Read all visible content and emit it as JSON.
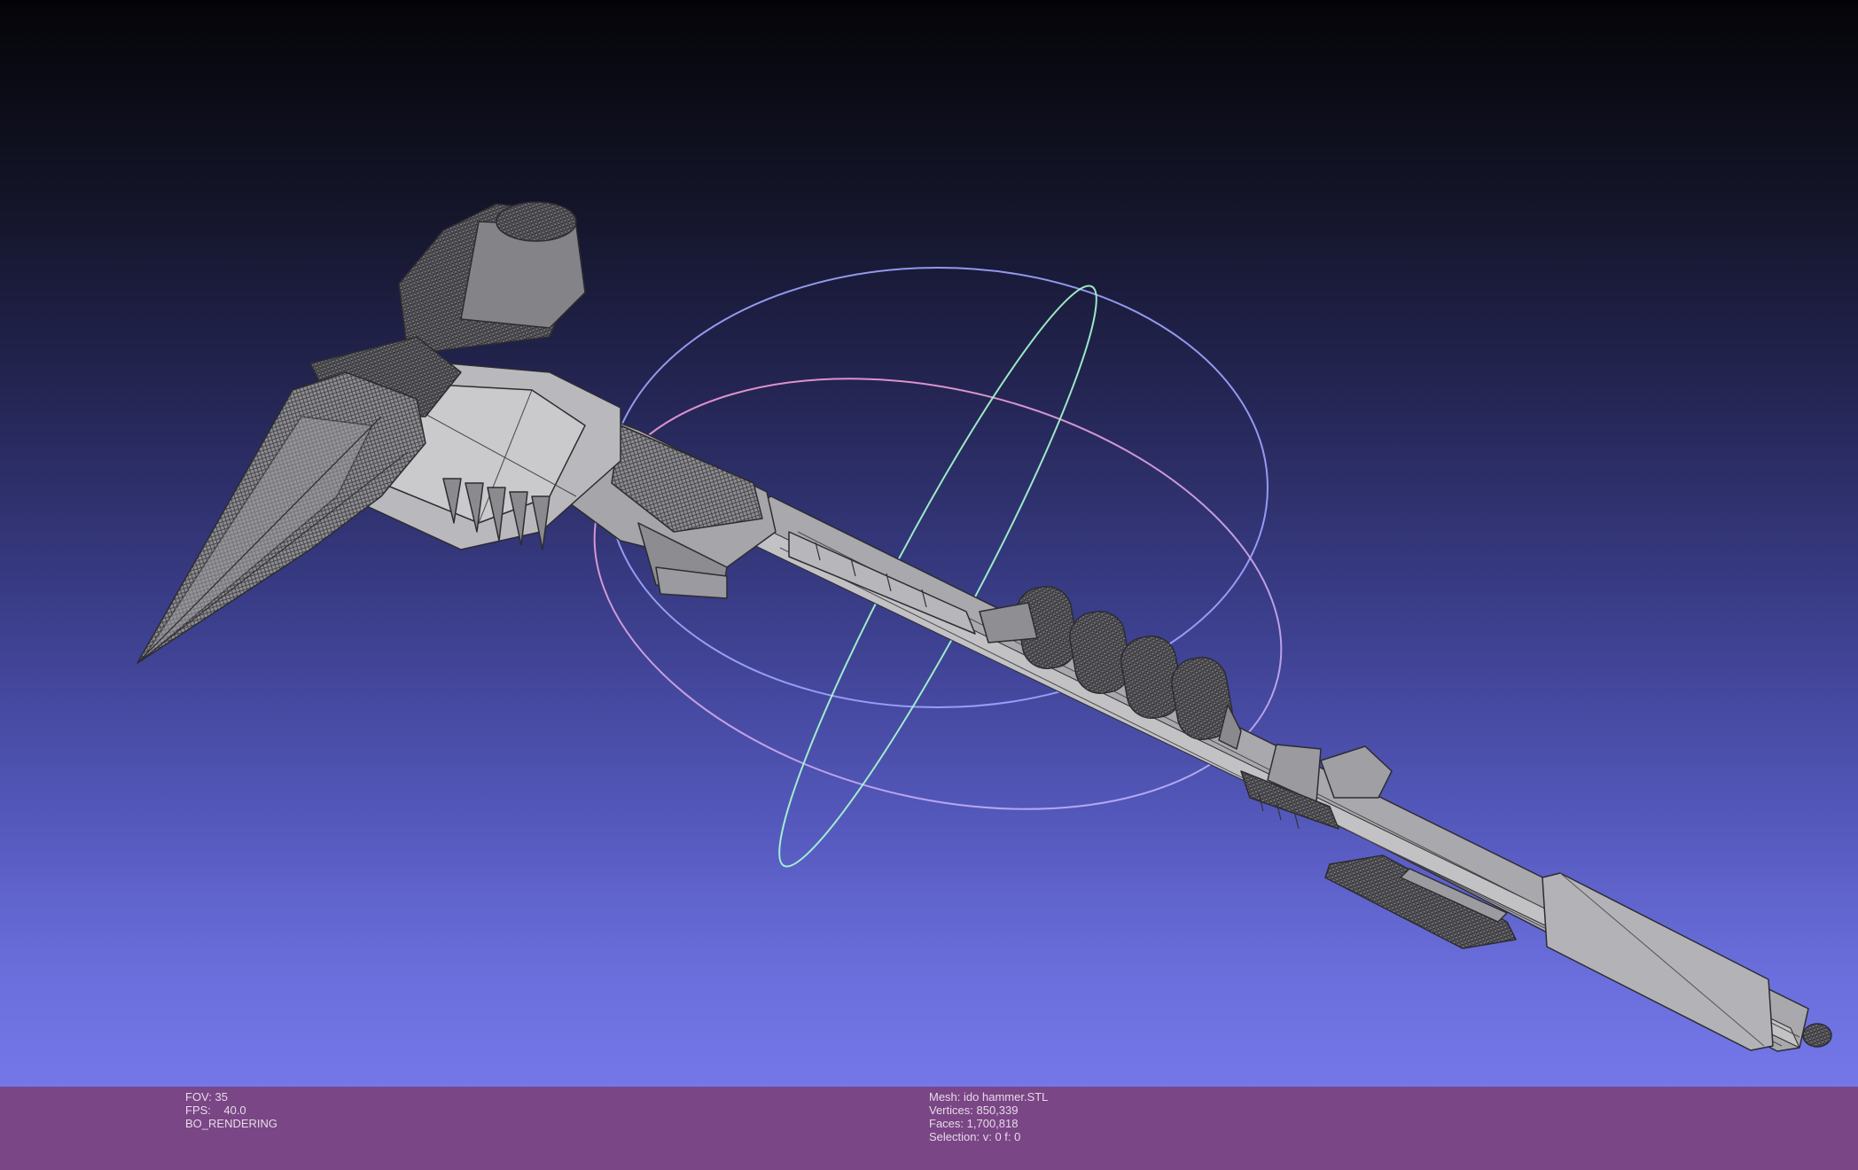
{
  "viewer": {
    "fov_label": "FOV:",
    "fov_value": "35",
    "fps_label": "FPS:",
    "fps_value": "40.0",
    "render_mode": "BO_RENDERING"
  },
  "mesh": {
    "name_label": "Mesh:",
    "name": "ido hammer.STL",
    "vertices_label": "Vertices:",
    "vertices": "850,339",
    "faces_label": "Faces:",
    "faces": "1,700,818",
    "selection_label": "Selection:",
    "selection": "v: 0 f: 0"
  },
  "colors": {
    "status_bar": "#7a4685",
    "trackball_horizontal": "#9aa0ff",
    "trackball_vertical": "#a8ffd0",
    "trackball_tilted": "#ff9ad0",
    "mesh_fill": "#9a9a9c",
    "mesh_wire": "#3a3a3e"
  },
  "icons": {
    "trackball": "trackball-gizmo-icon",
    "model": "hammer-mesh-icon"
  }
}
